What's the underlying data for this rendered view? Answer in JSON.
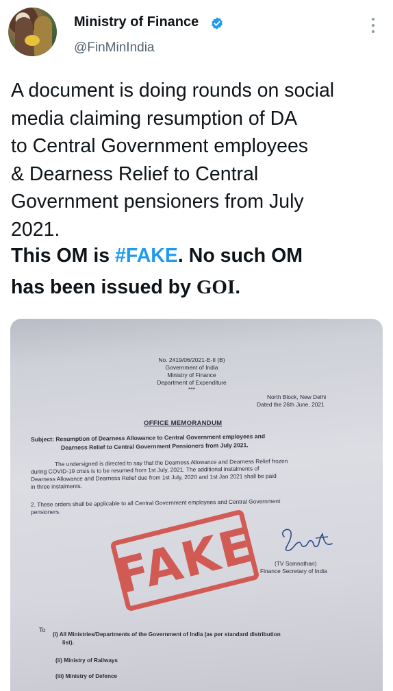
{
  "account": {
    "name": "Ministry of Finance",
    "handle": "@FinMinIndia",
    "verified_color": "#1d9bf0",
    "avatar_icon": "profile-photo",
    "more_icon": "vertical-ellipsis-icon"
  },
  "tweet": {
    "lines": [
      "A document is doing rounds on social",
      "media claiming resumption of DA",
      "to Central Government employees",
      "& Dearness Relief to Central",
      "Government pensioners from July",
      "2021."
    ],
    "bold_1_prefix": "This OM is ",
    "hashtag": "#FAKE",
    "bold_1_suffix": ".  No such OM",
    "bold_2_prefix": "has been issued by ",
    "bold_2_goi": "GOI",
    "bold_2_suffix": "."
  },
  "document": {
    "header": [
      "No. 2419/06/2021-E-II (B)",
      "Government of India",
      "Ministry of Finance",
      "Department of Expenditure",
      "***"
    ],
    "place": "North Block, New Delhi",
    "date": "Dated the 26th June, 2021",
    "title": "OFFICE MEMORANDUM",
    "subject_1": "Subject: Resumption of Dearness Allowance to Central Government employees and",
    "subject_2": "Dearness Relief to Central Government Pensioners from July 2021.",
    "para1": [
      "The undersigned is directed to say that the Dearness Allowance and Dearness Relief frozen",
      "during COVID-19 crisis is to be resumed from 1st July, 2021. The additional instalments of",
      "Dearness Allowance and Dearness Relief due from 1st July, 2020 and 1st Jan 2021 shall be paid",
      "in three instalments."
    ],
    "para2": [
      "2. These orders shall be applicable to all Central Government employees and Central Government",
      "pensioners."
    ],
    "stamp": "FAKE",
    "signatory": "(TV Somnathan)",
    "designation": "Finance Secretary of India",
    "to": "To",
    "distribution": [
      "(i) All Ministries/Departments of the Government of India (as per standard distribution",
      "list).",
      "(ii) Ministry of Railways",
      "(iii) Ministry of Defence"
    ]
  }
}
